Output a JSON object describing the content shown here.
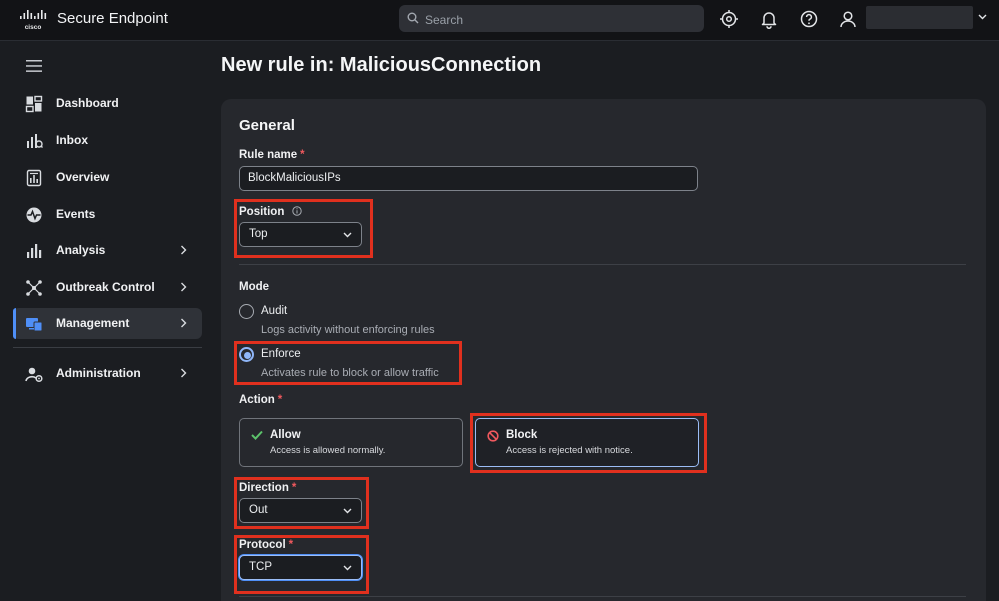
{
  "header": {
    "brand_text": "cisco",
    "app_title": "Secure Endpoint",
    "search": {
      "placeholder": "Search",
      "value": ""
    },
    "icons": [
      "target-icon",
      "bell-icon",
      "help-icon",
      "user-icon"
    ]
  },
  "sidebar": {
    "items": [
      {
        "label": "Dashboard",
        "icon": "dashboard-icon",
        "has_chevron": false
      },
      {
        "label": "Inbox",
        "icon": "inbox-icon",
        "has_chevron": false
      },
      {
        "label": "Overview",
        "icon": "overview-icon",
        "has_chevron": false
      },
      {
        "label": "Events",
        "icon": "events-icon",
        "has_chevron": false
      },
      {
        "label": "Analysis",
        "icon": "analysis-icon",
        "has_chevron": true
      },
      {
        "label": "Outbreak Control",
        "icon": "outbreak-icon",
        "has_chevron": true
      },
      {
        "label": "Management",
        "icon": "management-icon",
        "has_chevron": true,
        "active": true
      },
      {
        "label": "Administration",
        "icon": "administration-icon",
        "has_chevron": true
      }
    ]
  },
  "page": {
    "title": "New rule in: MaliciousConnection"
  },
  "form": {
    "section_title": "General",
    "rule_name": {
      "label": "Rule name",
      "required_mark": "*",
      "value": "BlockMaliciousIPs"
    },
    "position": {
      "label": "Position",
      "value": "Top"
    },
    "mode": {
      "label": "Mode",
      "options": [
        {
          "label": "Audit",
          "description": "Logs activity without enforcing rules",
          "selected": false
        },
        {
          "label": "Enforce",
          "description": "Activates rule to block or allow traffic",
          "selected": true
        }
      ]
    },
    "action": {
      "label": "Action",
      "required_mark": "*",
      "options": [
        {
          "label": "Allow",
          "description": "Access is allowed normally.",
          "icon": "check-icon",
          "selected": false
        },
        {
          "label": "Block",
          "description": "Access is rejected with notice.",
          "icon": "block-icon",
          "selected": true
        }
      ]
    },
    "direction": {
      "label": "Direction",
      "required_mark": "*",
      "value": "Out"
    },
    "protocol": {
      "label": "Protocol",
      "required_mark": "*",
      "value": "TCP"
    }
  },
  "colors": {
    "accent": "#4f8ff7",
    "required": "#f0595e",
    "highlight": "#e0301e",
    "allow_check": "#5cc36b",
    "block_icon": "#f0595e"
  }
}
